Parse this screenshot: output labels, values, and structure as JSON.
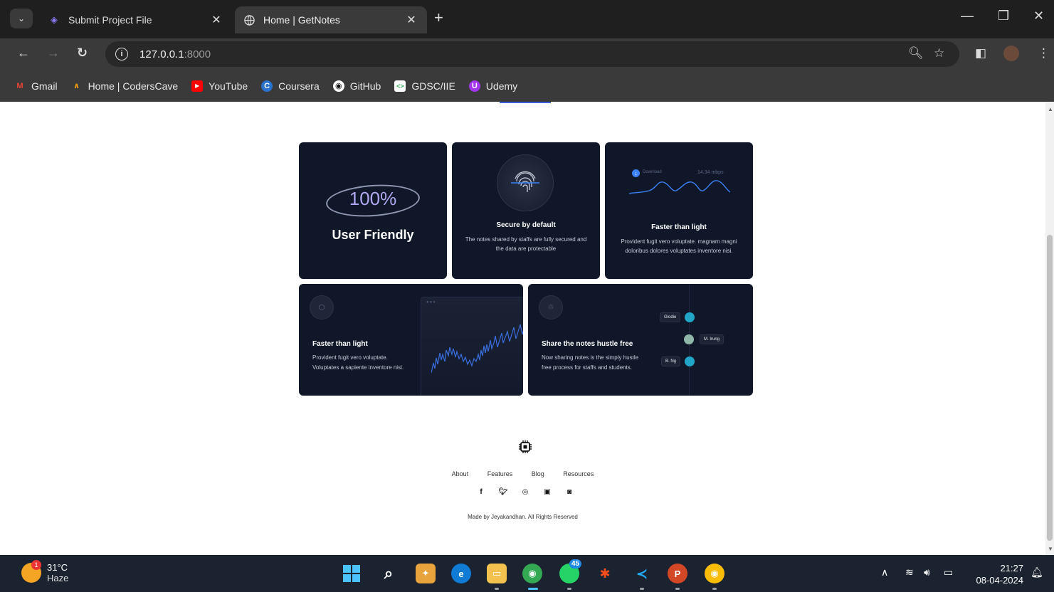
{
  "browser": {
    "tabs": [
      {
        "title": "Submit Project File",
        "active": false
      },
      {
        "title": "Home | GetNotes",
        "active": true
      }
    ],
    "url_host": "127.0.0.1",
    "url_port": ":8000",
    "bookmarks": [
      {
        "label": "Gmail",
        "icon": "gmail-icon",
        "color": "#ea4335"
      },
      {
        "label": "Home | CodersCave",
        "icon": "coderscave-icon",
        "color": "#f59e0b"
      },
      {
        "label": "YouTube",
        "icon": "youtube-icon",
        "color": "#ff0000"
      },
      {
        "label": "Coursera",
        "icon": "coursera-icon",
        "color": "#2a73cc"
      },
      {
        "label": "GitHub",
        "icon": "github-icon",
        "color": "#ffffff"
      },
      {
        "label": "GDSC/IIE",
        "icon": "gdsc-icon",
        "color": "#34a853"
      },
      {
        "label": "Udemy",
        "icon": "udemy-icon",
        "color": "#a435f0"
      }
    ]
  },
  "features": {
    "card1": {
      "percent": "100%",
      "title": "User Friendly"
    },
    "card2": {
      "title": "Secure by default",
      "desc": "The notes shared by staffs are fully secured and the data are protectable"
    },
    "card3": {
      "download_label": "Download",
      "speed": "14.34 mbps",
      "title": "Faster than light",
      "desc": "Provident fugit vero voluptate. magnam magni doloribus dolores voluptates inventore nisi."
    },
    "card4": {
      "title": "Faster than light",
      "desc": "Provident fugit vero voluptate. Voluptates a sapiente inventore nisi."
    },
    "card5": {
      "title": "Share the notes hustle free",
      "desc": "Now sharing notes is the simply hustle free process for staffs and students.",
      "people": [
        "Glodie",
        "M. Irung",
        "B. Ng"
      ]
    }
  },
  "footer": {
    "links": [
      "About",
      "Features",
      "Blog",
      "Resources"
    ],
    "social": [
      "facebook-icon",
      "twitter-icon",
      "github-icon",
      "linkedin-icon",
      "instagram-icon"
    ],
    "copyright": "Made by Jeyakandhan. All Rights Reserved"
  },
  "taskbar": {
    "weather_temp": "31°C",
    "weather_desc": "Haze",
    "weather_badge": "1",
    "whatsapp_badge": "45",
    "time": "21:27",
    "date": "08-04-2024"
  }
}
